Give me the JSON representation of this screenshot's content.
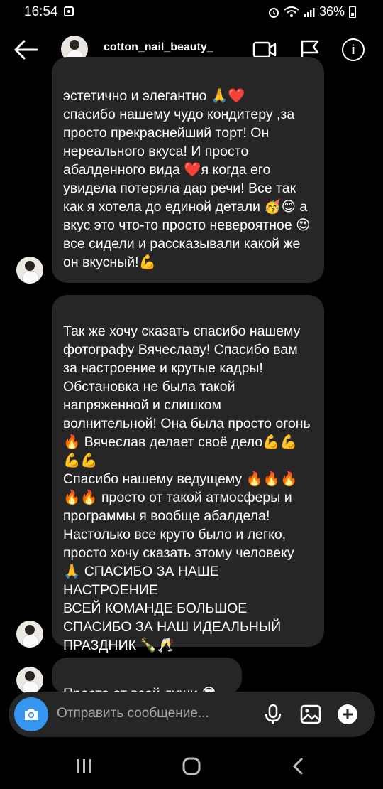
{
  "status_bar": {
    "time": "16:54",
    "battery": "36%"
  },
  "header": {
    "username": "cotton_nail_beauty_",
    "info_label": "i"
  },
  "messages": [
    {
      "text": "эстетично и элегантно 🙏❤️\nспасибо нашему чудо кондитеру ,за просто прекраснейший торт! Он нереального вкуса! И просто абалденного вида ❤️я когда его увидела потеряла дар речи! Все так как я хотела до единой детали 🥳😊 а вкус это что-то просто невероятное 😍все сидели и рассказывали какой же он вкусный!💪"
    },
    {
      "text": "Так же хочу сказать спасибо нашему фотографу Вячеславу! Спасибо вам за настроение и крутые кадры! Обстановка не была такой напряженной и слишком волнительной! Она была просто огонь 🔥 Вячеслав делает своё дело💪💪💪💪\nСпасибо нашему ведущему 🔥🔥🔥🔥🔥 просто от такой атмосферы и программы я вообще  абалдела! Настолько все круто было и легко, просто хочу сказать этому человеку 🙏 СПАСИБО ЗА НАШЕ НАСТРОЕНИЕ\n ВСЕЙ КОМАНДЕ БОЛЬШОЕ СПАСИБО ЗА НАШ ИДЕАЛЬНЫЙ ПРАЗДНИК 🍾🥂"
    },
    {
      "text": "Просто от всей души 😎"
    }
  ],
  "composer": {
    "placeholder": "Отправить сообщение..."
  },
  "colors": {
    "bubble_bg": "#262626",
    "camera_blue": "#3797f0"
  }
}
